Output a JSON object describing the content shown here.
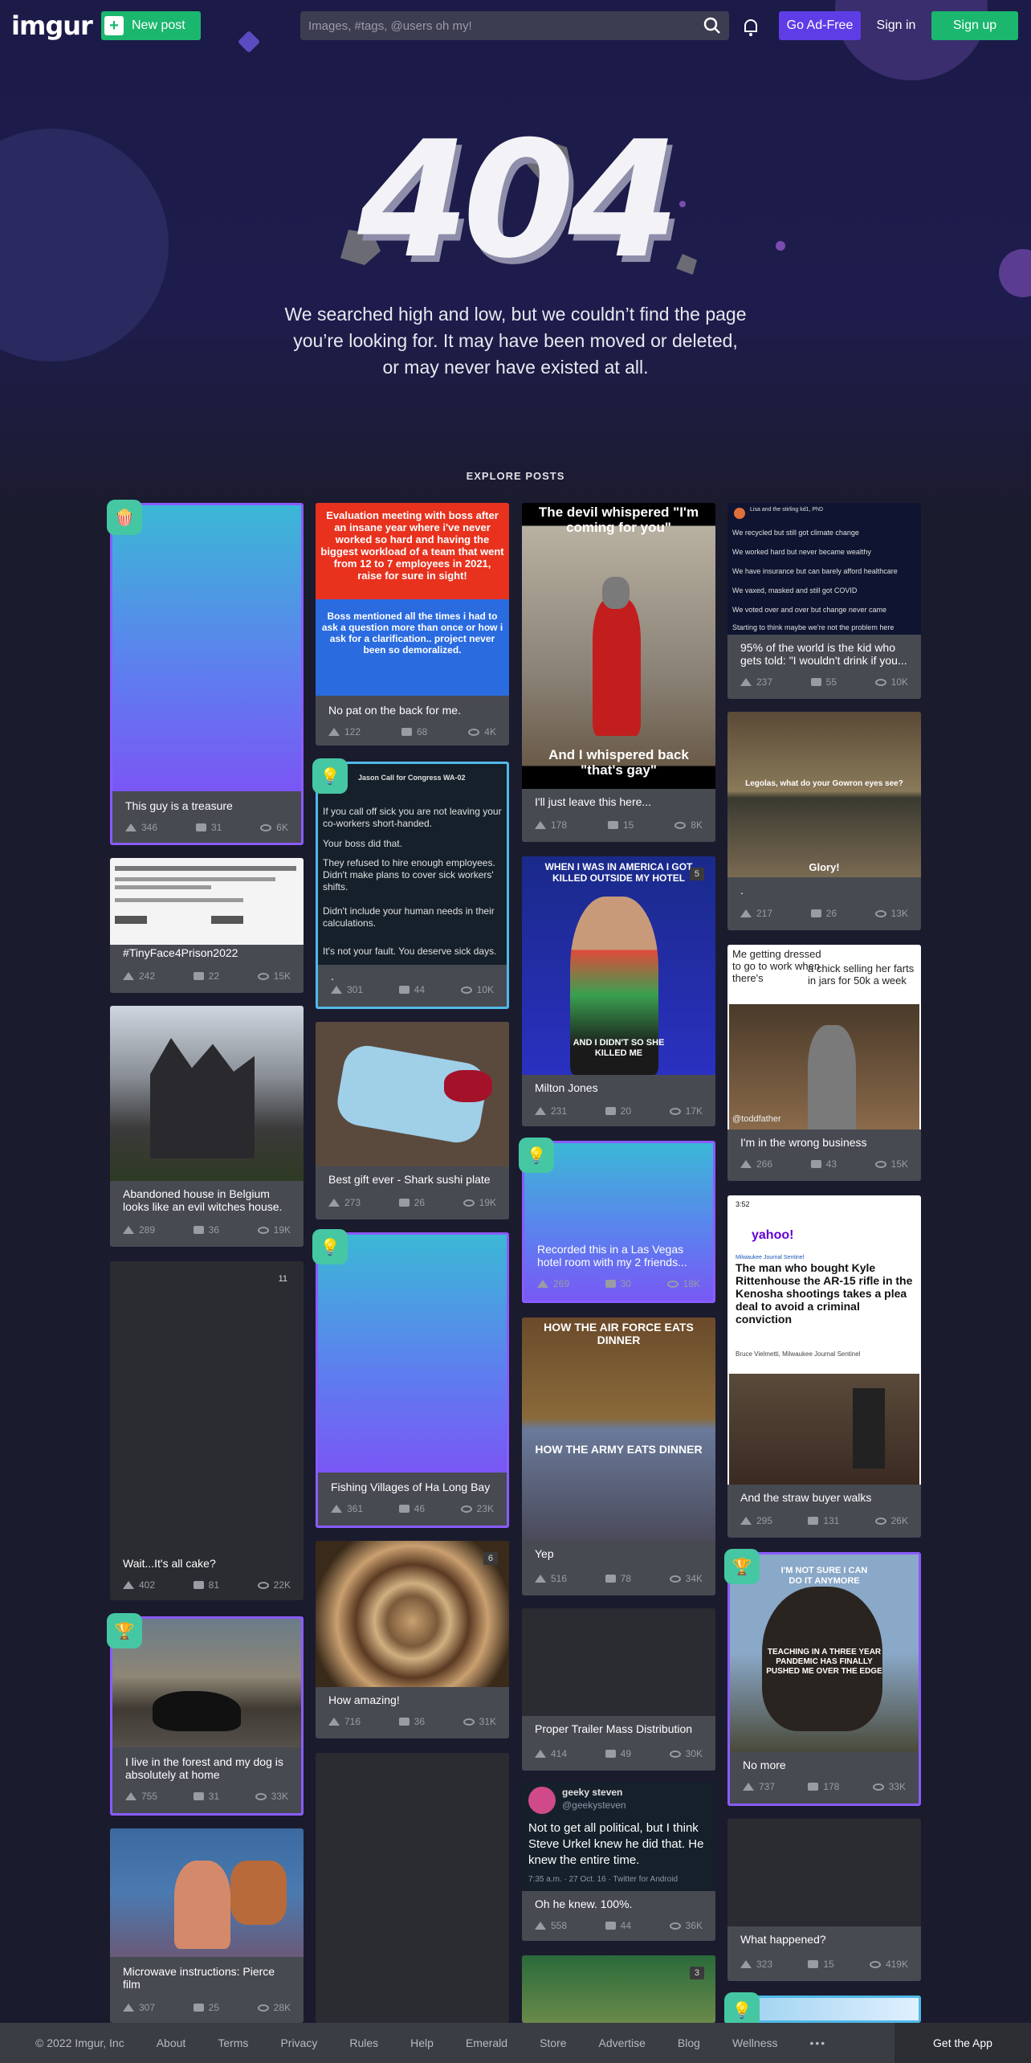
{
  "header": {
    "logo": "imgur",
    "new_post": "New post",
    "search_placeholder": "Images, #tags, @users oh my!",
    "go_ad_free": "Go Ad-Free",
    "sign_in": "Sign in",
    "sign_up": "Sign up"
  },
  "error": {
    "code": "404",
    "message": "We searched high and low, but we couldn’t find the page you’re looking for. It may have been moved or deleted, or may never have existed at all."
  },
  "explore_heading": "EXPLORE POSTS",
  "posts": [
    {
      "title": "This guy is a treasure",
      "ups": "346",
      "comments": "31",
      "views": "6K"
    },
    {
      "title": "#TinyFace4Prison2022",
      "ups": "242",
      "comments": "22",
      "views": "15K"
    },
    {
      "title": "Abandoned house in Belgium looks like an evil witches house.",
      "ups": "289",
      "comments": "36",
      "views": "19K"
    },
    {
      "title": "Wait...It's all cake?",
      "ups": "402",
      "comments": "81",
      "views": "22K",
      "count": "11"
    },
    {
      "title": "I live in the forest and my dog is absolutely at home",
      "ups": "755",
      "comments": "31",
      "views": "33K"
    },
    {
      "title": "Microwave instructions: Pierce film",
      "ups": "307",
      "comments": "25",
      "views": "28K"
    },
    {
      "title": "No pat on the back for me.",
      "ups": "122",
      "comments": "68",
      "views": "4K"
    },
    {
      "title": ".",
      "ups": "301",
      "comments": "44",
      "views": "10K"
    },
    {
      "title": "Best gift ever - Shark sushi plate",
      "ups": "273",
      "comments": "26",
      "views": "19K"
    },
    {
      "title": "Fishing Villages of Ha Long Bay",
      "ups": "361",
      "comments": "46",
      "views": "23K"
    },
    {
      "title": "How amazing!",
      "ups": "716",
      "comments": "36",
      "views": "31K",
      "count": "6"
    },
    {
      "title": "I'll just leave this here...",
      "ups": "178",
      "comments": "15",
      "views": "8K"
    },
    {
      "title": "Milton Jones",
      "ups": "231",
      "comments": "20",
      "views": "17K",
      "count": "5"
    },
    {
      "title": "Recorded this in a Las Vegas hotel room with my 2 friends...",
      "ups": "269",
      "comments": "30",
      "views": "18K"
    },
    {
      "title": "Yep",
      "ups": "516",
      "comments": "78",
      "views": "34K"
    },
    {
      "title": "Proper Trailer Mass Distribution",
      "ups": "414",
      "comments": "49",
      "views": "30K"
    },
    {
      "title": "Oh he knew. 100%.",
      "ups": "558",
      "comments": "44",
      "views": "36K"
    },
    {
      "title": "95% of the world is the kid who gets told: \"I wouldn't drink if you...",
      "ups": "237",
      "comments": "55",
      "views": "10K"
    },
    {
      "title": ".",
      "ups": "217",
      "comments": "26",
      "views": "13K"
    },
    {
      "title": "I'm in the wrong business",
      "ups": "266",
      "comments": "43",
      "views": "15K"
    },
    {
      "title": "And the straw buyer walks",
      "ups": "295",
      "comments": "131",
      "views": "26K"
    },
    {
      "title": "No more",
      "ups": "737",
      "comments": "178",
      "views": "33K"
    },
    {
      "title": "What happened?",
      "ups": "323",
      "comments": "15",
      "views": "419K"
    }
  ],
  "image_text": {
    "devil_top": "The devil whispered \"I'm coming for you\"",
    "devil_bottom": "And I whispered back \"that's gay\"",
    "boss_top": "Evaluation meeting with boss after an insane year where i've never worked so hard and having the biggest workload of a team that went from 12 to 7 employees in 2021, raise for sure in sight!",
    "boss_bottom": "Boss mentioned all the times i had to ask a question more than once or how i ask for a clarification..  project never been so demoralized.",
    "milton_top": "WHEN I WAS IN AMERICA I GOT KILLED OUTSIDE MY HOTEL",
    "milton_bottom": "AND I DIDN'T SO SHE KILLED ME",
    "airforce": "HOW THE AIR FORCE EATS DINNER",
    "army": "HOW THE ARMY EATS DINNER",
    "aragorn_1": "Legolas, what do your Gowron eyes see?",
    "aragorn_2": "Glory!",
    "business_top": "Me getting dressed to go to work when there's",
    "business_right": "a chick selling her farts in jars for 50k a week",
    "bear": "I'M NOT SURE I CAN DO IT ANYMORE",
    "bear_2": "TEACHING IN A THREE YEAR PANDEMIC HAS FINALLY PUSHED ME OVER THE EDGE",
    "yahoo_headline": "The man who bought Kyle Rittenhouse the AR-15 rifle in the Kenosha shootings takes a plea deal to avoid a criminal conviction",
    "yahoo_source": "Milwaukee Journal Sentinel",
    "yahoo_byline": "Bruce Vielmetti, Milwaukee Journal Sentinel",
    "yahoo_logo": "yahoo!",
    "time": "3:52",
    "tweet_handle": "Jason Call for Congress WA-02",
    "tweet_lines": [
      "If you call off sick you are not leaving your co-workers short-handed.",
      "Your boss did that.",
      "They refused to hire enough employees. Didn't make plans to cover sick workers' shifts.",
      "Didn't include your human needs in their calculations.",
      "It's not your fault. You deserve sick days."
    ],
    "geeky_name": "geeky steven",
    "geeky_handle": "@geekysteven",
    "geeky_text": "Not to get all political, but I think Steve Urkel knew he did that. He knew the entire time.",
    "geeky_meta": "7:35 a.m. · 27 Oct. 16 · Twitter for Android",
    "kid_lines": [
      "We recycled but still got climate change",
      "We worked hard but never became wealthy",
      "We have insurance but can barely afford healthcare",
      "We vaxed, masked and still got COVID",
      "We voted over and over but change never came",
      "Starting to think maybe we're not the problem here"
    ],
    "kid_author": "Lisa and the stirling kd1, PhD",
    "todd": "@toddfather"
  },
  "footer": {
    "copyright": "© 2022 Imgur, Inc",
    "links": [
      "About",
      "Terms",
      "Privacy",
      "Rules",
      "Help",
      "Emerald",
      "Store",
      "Advertise",
      "Blog",
      "Wellness"
    ],
    "more": "•••",
    "get_app": "Get the App"
  },
  "colors": {
    "accent_green": "#1bb76e",
    "ad_free_purple": "#5e3de7",
    "card_bg": "#474a51",
    "promoted_border": "#8a5cff"
  }
}
